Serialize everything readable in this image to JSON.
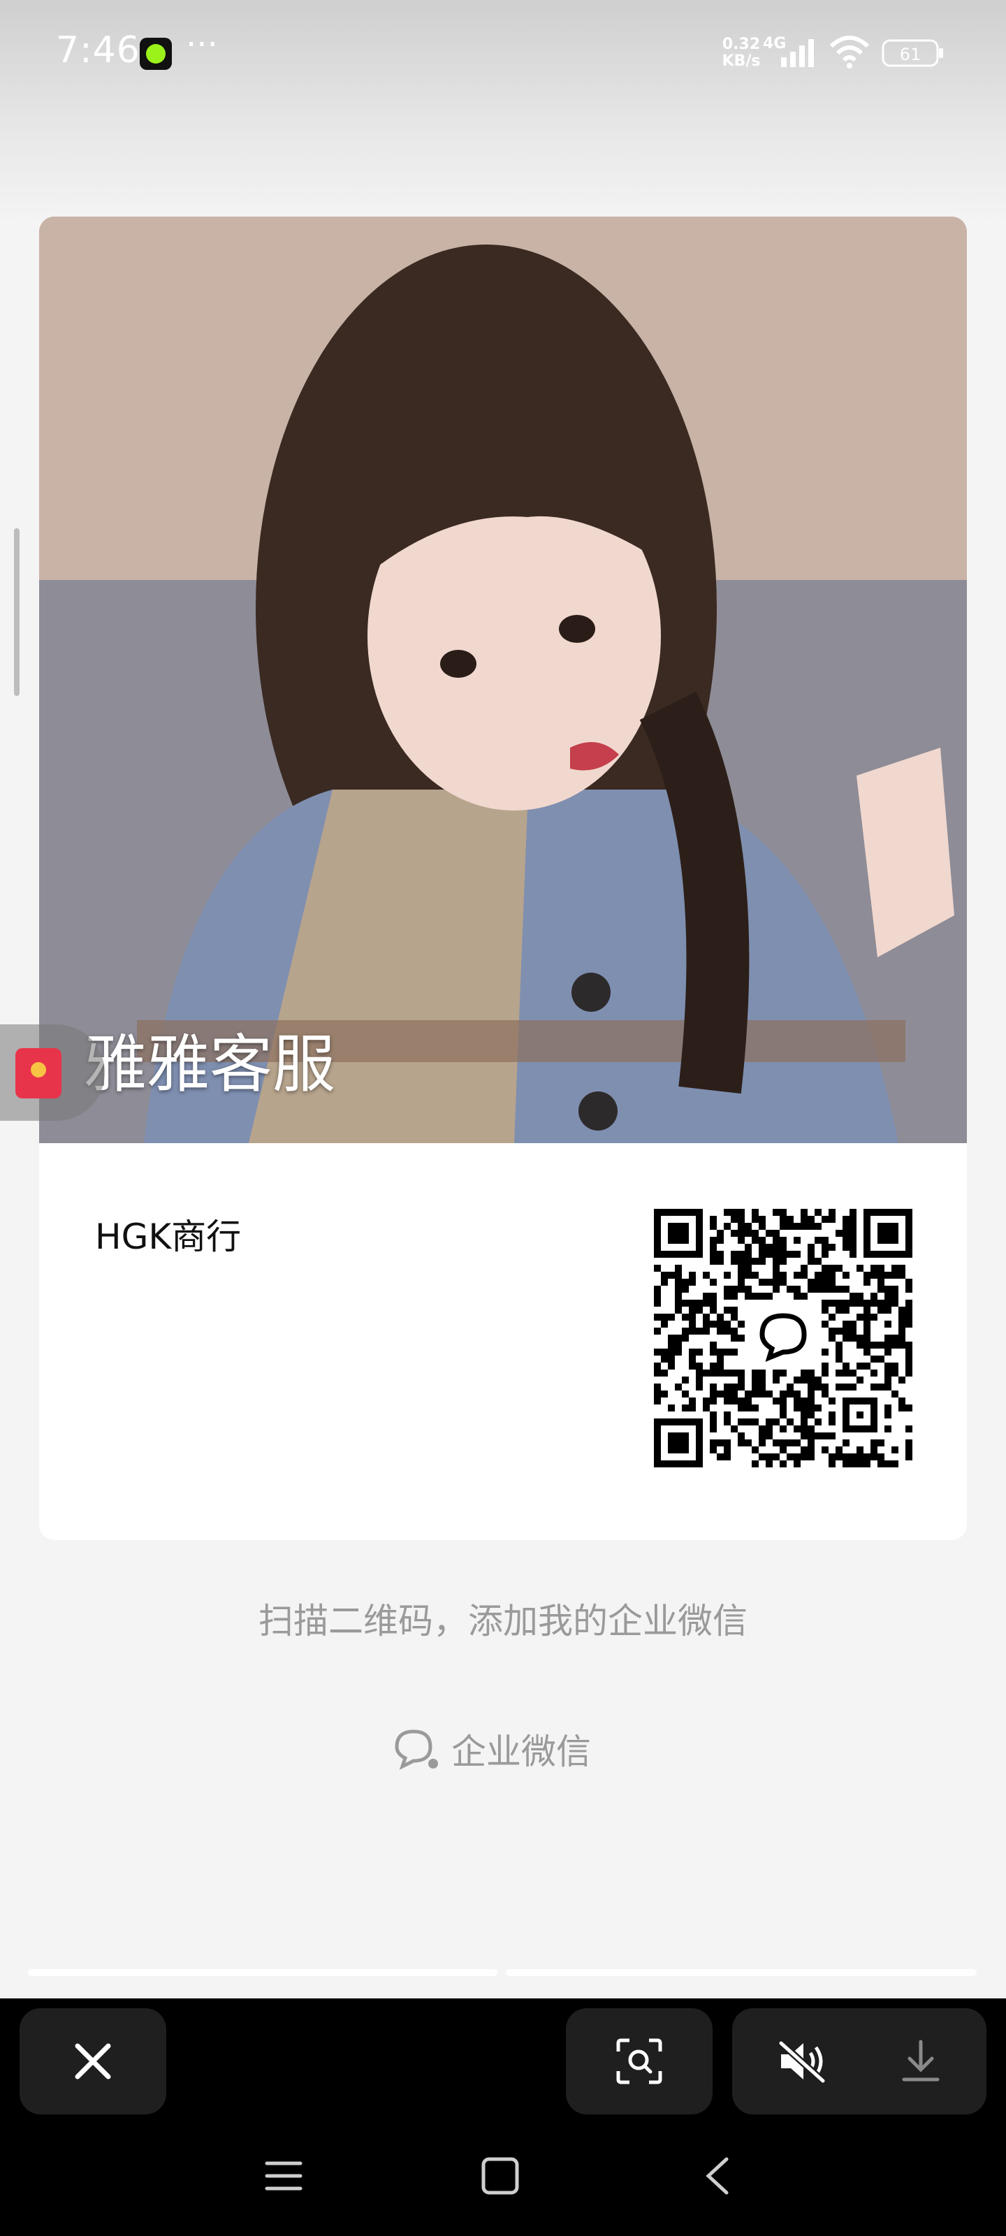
{
  "status_bar": {
    "time": "7:46",
    "net_speed_value": "0.32",
    "net_speed_unit": "KB/s",
    "network": "4G",
    "battery": "61"
  },
  "card": {
    "photo_label": "雅雅客服",
    "company": "HGK商行",
    "qr_center_icon": "wechat-work-icon"
  },
  "caption": "扫描二维码，添加我的企业微信",
  "brand": {
    "icon": "wechat-work-icon",
    "label": "企业微信"
  },
  "bottom_bar": {
    "close_icon": "close-icon",
    "scan_icon": "scan-icon",
    "mute_icon": "speaker-muted-icon",
    "download_icon": "download-icon"
  },
  "colors": {
    "caption_gray": "#9a9a9a",
    "redpacket_red": "#e8344a"
  }
}
